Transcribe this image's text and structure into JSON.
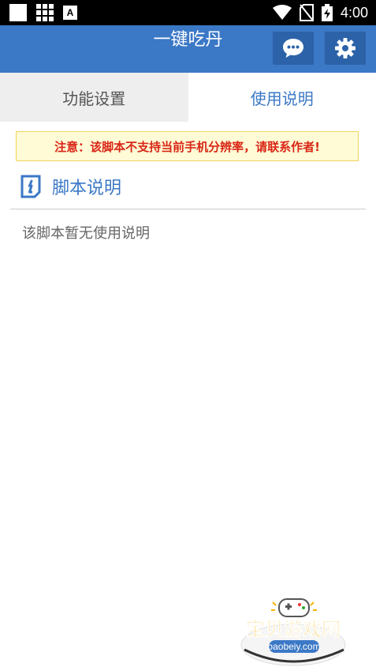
{
  "status_bar": {
    "time": "4:00",
    "icons": [
      "white-square-icon",
      "grid-icon",
      "accessibility-a-icon",
      "wifi-icon",
      "no-sim-icon",
      "battery-charging-icon"
    ],
    "a_icon_text": "A"
  },
  "appbar": {
    "title": "一键吃丹",
    "color": "#3b78c6",
    "icons": [
      "chat-icon",
      "gear-icon"
    ]
  },
  "tabs": [
    {
      "label": "功能设置",
      "active": false
    },
    {
      "label": "使用说明",
      "active": true
    }
  ],
  "warning": {
    "text": "注意：该脚本不支持当前手机分辨率，请联系作者!"
  },
  "section": {
    "icon": "info-icon",
    "title": "脚本说明",
    "body": "该脚本暂无使用说明"
  },
  "watermark": {
    "brand": "宝贝游戏网",
    "url": "baobeiy.com",
    "icon": "gamepad-icon"
  }
}
